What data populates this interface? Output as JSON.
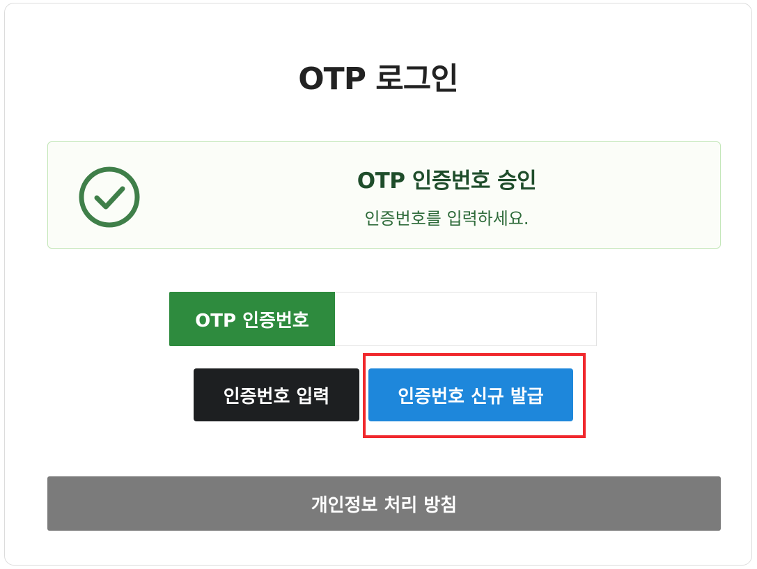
{
  "page": {
    "title": "OTP 로그인"
  },
  "alert": {
    "icon": "check-circle-icon",
    "title": "OTP 인증번호 승인",
    "message": "인증번호를 입력하세요."
  },
  "otp_field": {
    "label": "OTP 인증번호",
    "value": "",
    "placeholder": ""
  },
  "buttons": {
    "submit_label": "인증번호 입력",
    "new_code_label": "인증번호 신규 발급",
    "privacy_label": "개인정보 처리 방침"
  },
  "colors": {
    "success_green": "#2e8b3e",
    "primary_blue": "#1e87db",
    "dark_button": "#1d1f21",
    "gray_button": "#7b7b7b",
    "highlight_red": "#f0282d"
  }
}
